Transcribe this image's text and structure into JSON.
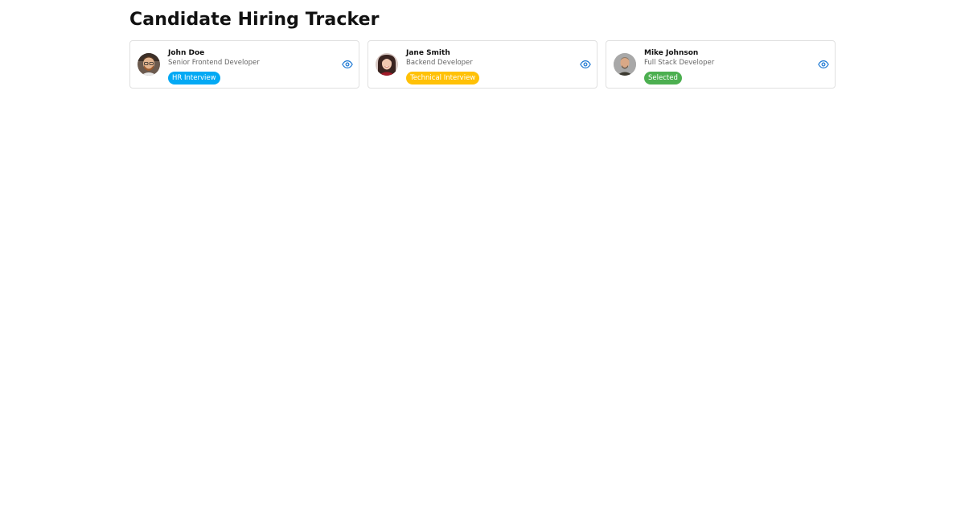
{
  "page": {
    "title": "Candidate Hiring Tracker"
  },
  "candidates": [
    {
      "name": "John Doe",
      "role": "Senior Frontend Developer",
      "status": "HR Interview",
      "status_color": "#03a9f4",
      "avatar_icon": "avatar-photo-icon",
      "action_icon": "eye-icon"
    },
    {
      "name": "Jane Smith",
      "role": "Backend Developer",
      "status": "Technical Interview",
      "status_color": "#ffc107",
      "avatar_icon": "avatar-photo-icon",
      "action_icon": "eye-icon"
    },
    {
      "name": "Mike Johnson",
      "role": "Full Stack Developer",
      "status": "Selected",
      "status_color": "#4caf50",
      "avatar_icon": "avatar-photo-icon",
      "action_icon": "eye-icon"
    }
  ],
  "colors": {
    "accent": "#1976d2",
    "border": "#e0e0e0"
  }
}
